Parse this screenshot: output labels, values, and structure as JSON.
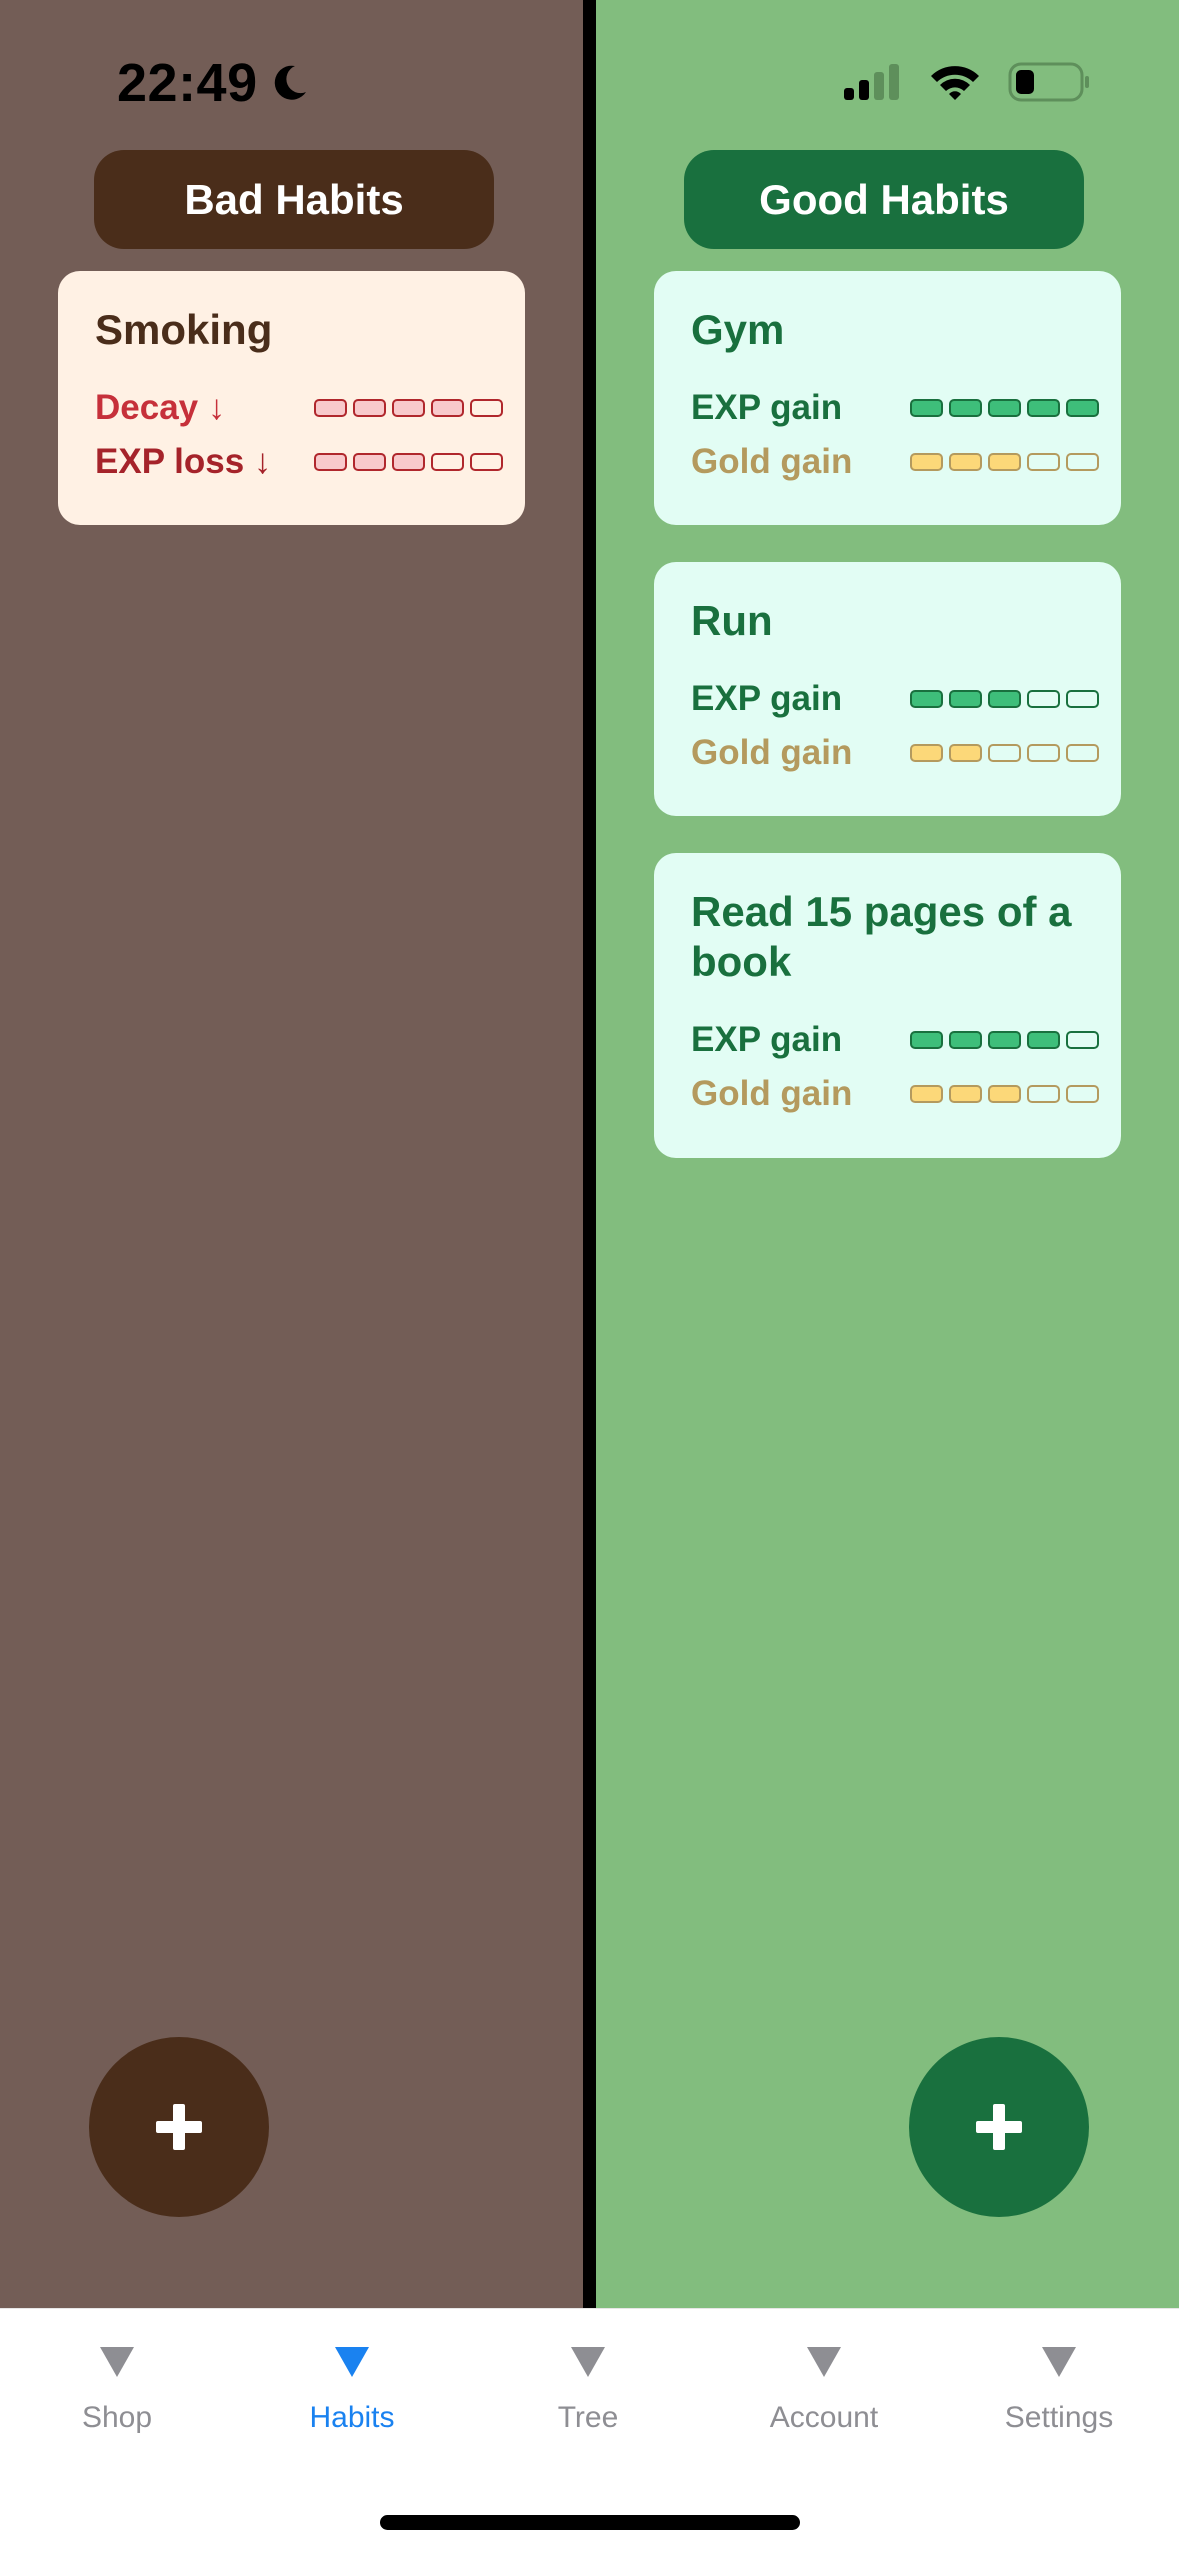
{
  "status_bar": {
    "time": "22:49",
    "icons": [
      "moon-icon",
      "cellular-signal-icon",
      "wifi-icon",
      "battery-icon"
    ]
  },
  "bad_habits": {
    "header": "Bad Habits",
    "accent": "#4a2d1a",
    "background": "#735d56",
    "cards": [
      {
        "title": "Smoking",
        "stats": [
          {
            "label": "Decay ↓",
            "filled": 4,
            "total": 5
          },
          {
            "label": "EXP loss ↓",
            "filled": 3,
            "total": 5
          }
        ]
      }
    ],
    "fab_icon": "plus-icon"
  },
  "good_habits": {
    "header": "Good Habits",
    "accent": "#19703e",
    "background": "#82bd7e",
    "cards": [
      {
        "title": "Gym",
        "stats": [
          {
            "label": "EXP gain",
            "filled": 5,
            "total": 5
          },
          {
            "label": "Gold gain",
            "filled": 3,
            "total": 5
          }
        ]
      },
      {
        "title": "Run",
        "stats": [
          {
            "label": "EXP gain",
            "filled": 3,
            "total": 5
          },
          {
            "label": "Gold gain",
            "filled": 2,
            "total": 5
          }
        ]
      },
      {
        "title": "Read 15 pages of a book",
        "stats": [
          {
            "label": "EXP gain",
            "filled": 4,
            "total": 5
          },
          {
            "label": "Gold gain",
            "filled": 3,
            "total": 5
          }
        ]
      }
    ],
    "fab_icon": "plus-icon"
  },
  "tabbar": {
    "active_color": "#1a82f0",
    "inactive_color": "#8e8e93",
    "tabs": [
      {
        "label": "Shop",
        "icon": "triangle-down-icon",
        "active": false
      },
      {
        "label": "Habits",
        "icon": "triangle-down-icon",
        "active": true
      },
      {
        "label": "Tree",
        "icon": "triangle-down-icon",
        "active": false
      },
      {
        "label": "Account",
        "icon": "triangle-down-icon",
        "active": false
      },
      {
        "label": "Settings",
        "icon": "triangle-down-icon",
        "active": false
      }
    ]
  }
}
